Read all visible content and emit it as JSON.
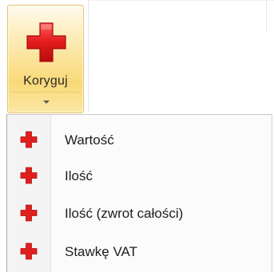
{
  "ribbon": {
    "koryguj_button": {
      "label": "Koryguj",
      "icon": "red-cross-icon",
      "state": "highlighted"
    }
  },
  "menu": {
    "items": [
      {
        "label": "Wartość",
        "icon": "red-cross-icon"
      },
      {
        "label": "Ilość",
        "icon": "red-cross-icon"
      },
      {
        "label": "Ilość (zwrot całości)",
        "icon": "red-cross-icon"
      },
      {
        "label": "Stawkę VAT",
        "icon": "red-cross-icon"
      }
    ]
  },
  "colors": {
    "icon_red": "#e02020",
    "icon_red_dark": "#b30f0f",
    "highlight_border": "#e2c26e",
    "highlight_fill": "#fbe39a"
  }
}
